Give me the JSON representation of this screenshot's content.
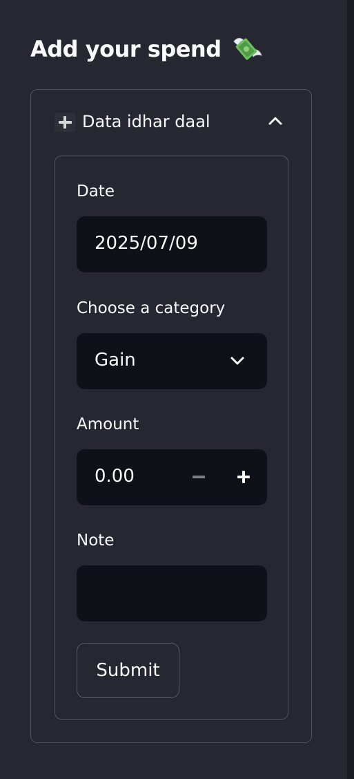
{
  "sidebar": {
    "title": "Add your spend",
    "title_icon": "money-with-wings-icon"
  },
  "expander": {
    "label": "Data idhar daal",
    "icon": "plus-icon",
    "expanded": true
  },
  "form": {
    "date": {
      "label": "Date",
      "value": "2025/07/09"
    },
    "category": {
      "label": "Choose a category",
      "selected": "Gain"
    },
    "amount": {
      "label": "Amount",
      "value": "0.00"
    },
    "note": {
      "label": "Note",
      "value": ""
    },
    "submit_label": "Submit"
  }
}
